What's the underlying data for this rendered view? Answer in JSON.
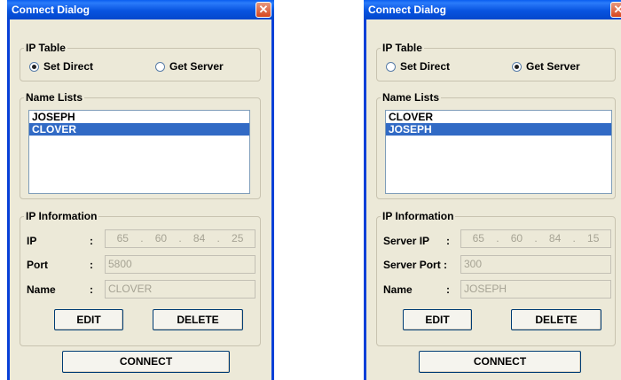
{
  "left": {
    "title": "Connect Dialog",
    "close_glyph": "✕",
    "ip_table": {
      "legend": "IP Table",
      "options": [
        {
          "label": "Set Direct",
          "selected": true
        },
        {
          "label": "Get Server",
          "selected": false
        }
      ]
    },
    "name_lists": {
      "legend": "Name Lists",
      "items": [
        "JOSEPH",
        "CLOVER"
      ],
      "selected_index": 1
    },
    "ip_info": {
      "legend": "IP Information",
      "ip_label": "IP",
      "ip_octets": [
        "65",
        "60",
        "84",
        "25"
      ],
      "port_label": "Port",
      "port_value": "5800",
      "name_label": "Name",
      "name_value": "CLOVER",
      "colon": ":",
      "dot": "."
    },
    "buttons": {
      "edit": "EDIT",
      "delete": "DELETE",
      "connect": "CONNECT"
    }
  },
  "right": {
    "title": "Connect Dialog",
    "close_glyph": "✕",
    "ip_table": {
      "legend": "IP Table",
      "options": [
        {
          "label": "Set Direct",
          "selected": false
        },
        {
          "label": "Get Server",
          "selected": true
        }
      ]
    },
    "name_lists": {
      "legend": "Name Lists",
      "items": [
        "CLOVER",
        "JOSEPH"
      ],
      "selected_index": 1
    },
    "ip_info": {
      "legend": "IP Information",
      "ip_label": "Server IP",
      "ip_octets": [
        "65",
        "60",
        "84",
        "15"
      ],
      "port_label": "Server Port :",
      "port_value": "300",
      "name_label": "Name",
      "name_value": "JOSEPH",
      "colon": ":",
      "dot": "."
    },
    "buttons": {
      "edit": "EDIT",
      "delete": "DELETE",
      "connect": "CONNECT"
    }
  },
  "colors": {
    "titlebar": "#0854e0",
    "selection": "#316ac5",
    "dialog_bg": "#ece9d8"
  }
}
